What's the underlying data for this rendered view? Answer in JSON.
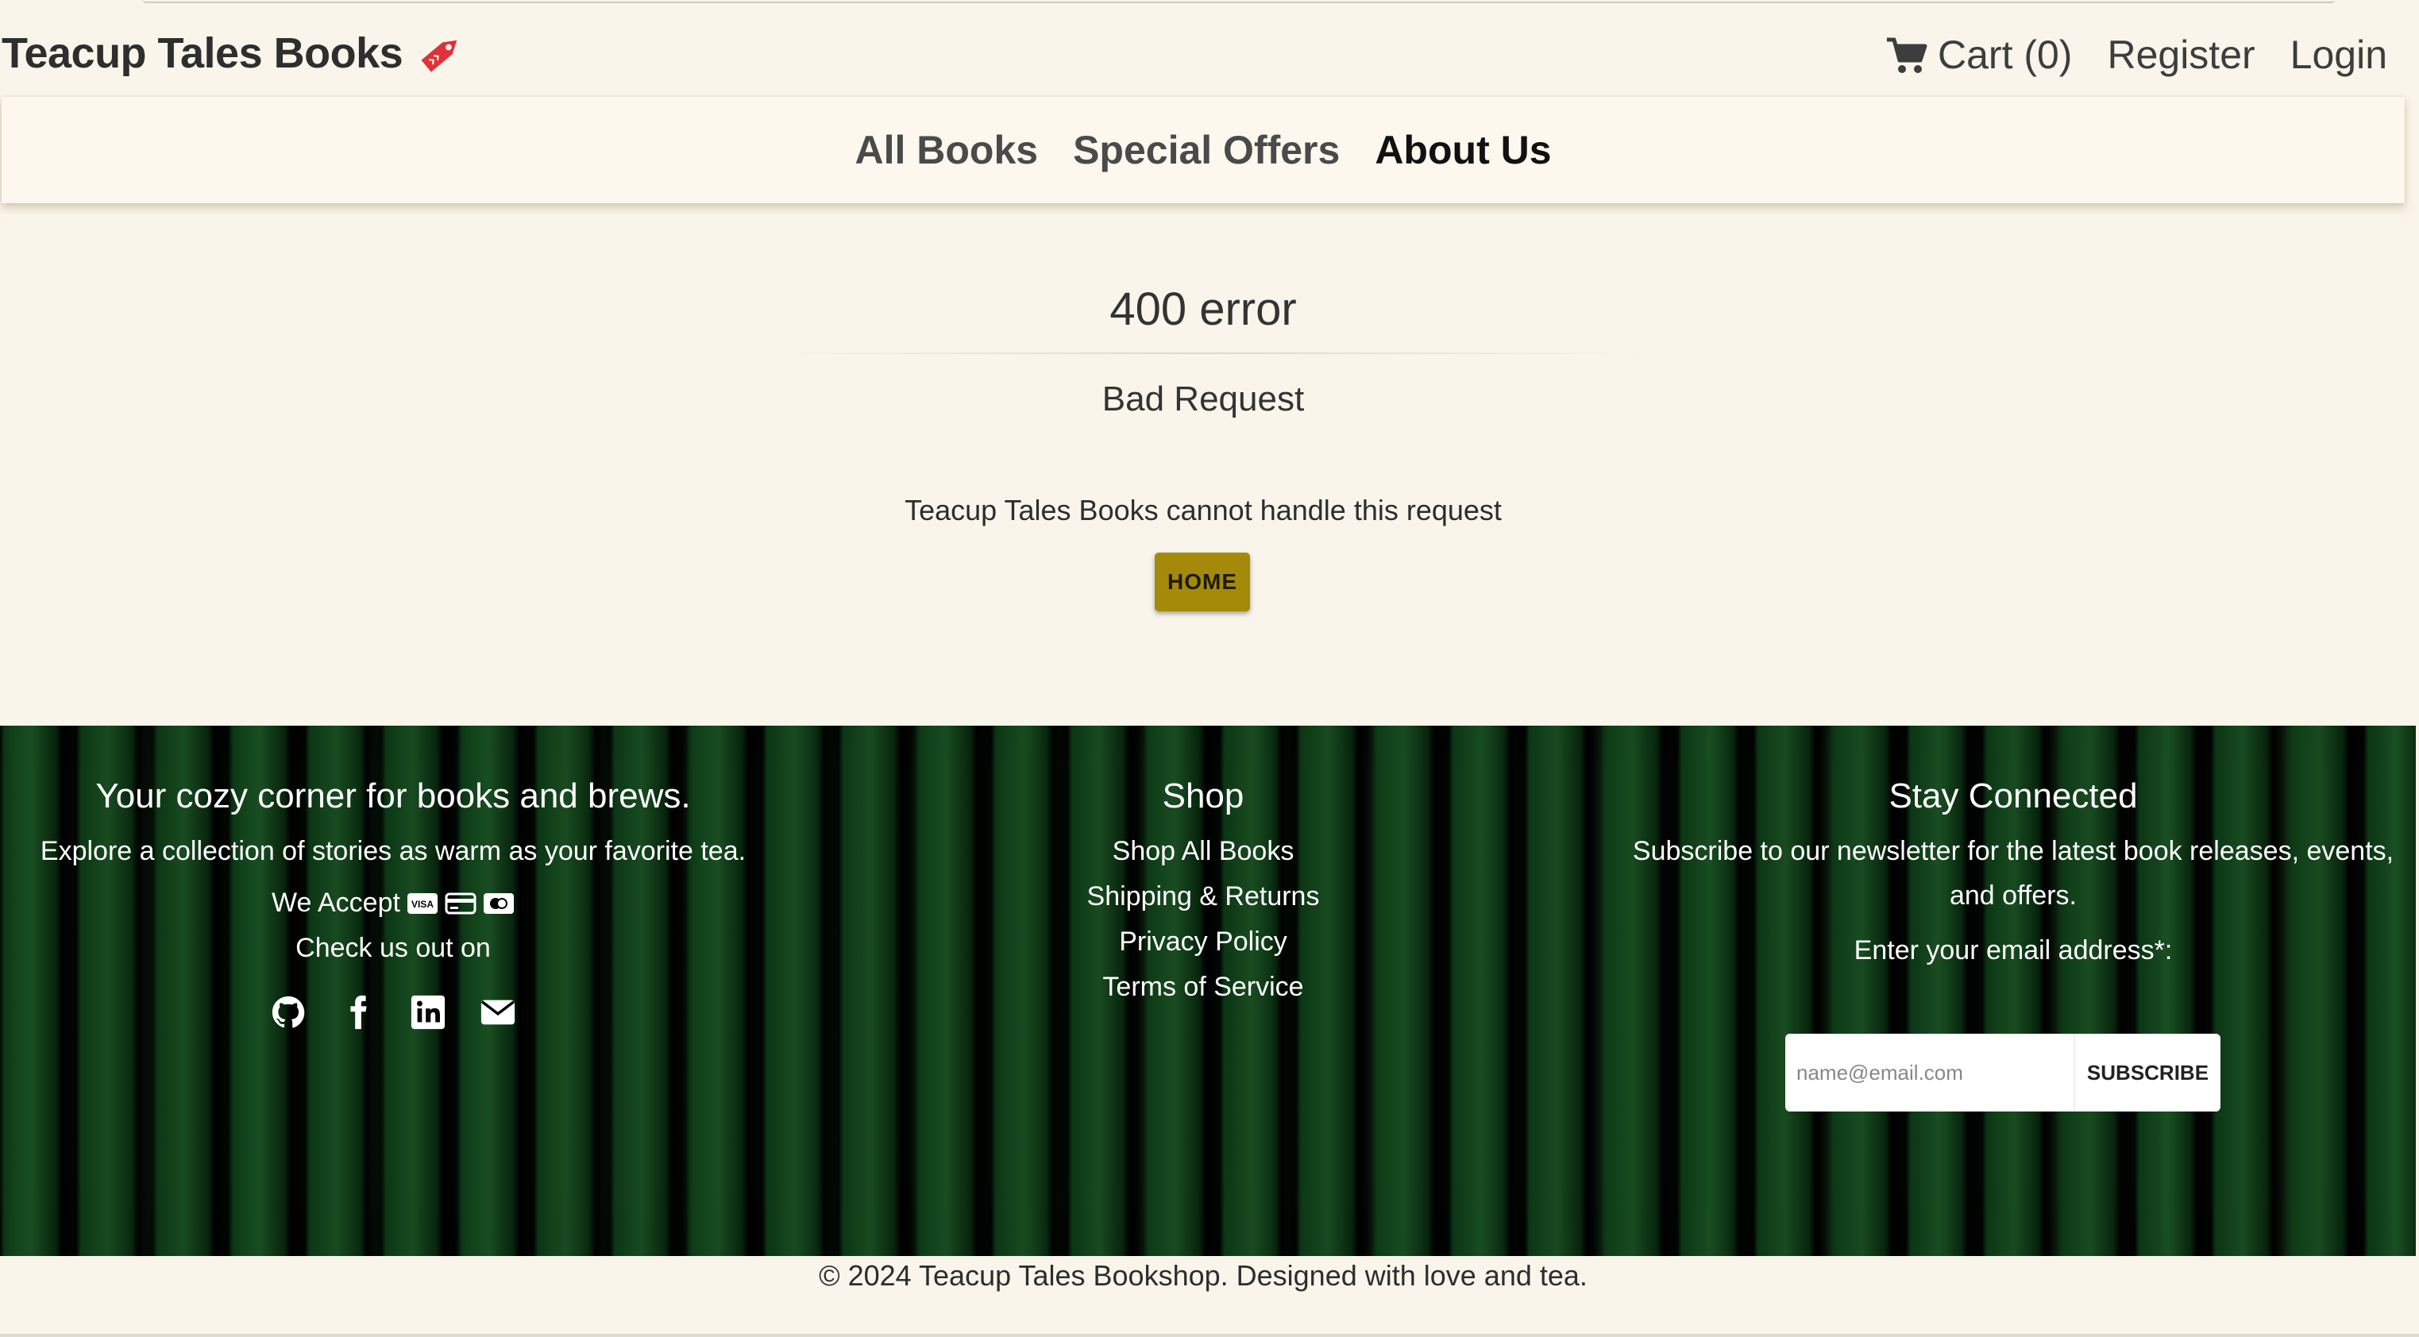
{
  "header": {
    "brand": "Teacup Tales Books",
    "cart_label": "Cart (0)",
    "register_label": "Register",
    "login_label": "Login"
  },
  "nav": {
    "items": [
      {
        "label": "All Books",
        "active": false
      },
      {
        "label": "Special Offers",
        "active": false
      },
      {
        "label": "About Us",
        "active": true
      }
    ]
  },
  "error": {
    "title": "400 error",
    "subtitle": "Bad Request",
    "message": "Teacup Tales Books cannot handle this request",
    "home_button": "HOME"
  },
  "footer": {
    "col1": {
      "heading": "Your cozy corner for books and brews.",
      "text": "Explore a collection of stories as warm as your favorite tea.",
      "accept_label": "We Accept",
      "check_label": "Check us out on",
      "payment_icons": [
        "visa-icon",
        "credit-card-icon",
        "mastercard-icon"
      ],
      "social_icons": [
        "github-icon",
        "facebook-icon",
        "linkedin-icon",
        "envelope-icon"
      ]
    },
    "col2": {
      "heading": "Shop",
      "links": [
        "Shop All Books",
        "Shipping & Returns",
        "Privacy Policy",
        "Terms of Service"
      ]
    },
    "col3": {
      "heading": "Stay Connected",
      "text": "Subscribe to our newsletter for the latest book releases, events, and offers.",
      "email_label": "Enter your email address*:",
      "email_placeholder": "name@email.com",
      "subscribe_label": "SUBSCRIBE"
    },
    "copyright": "© 2024 Teacup Tales Bookshop. Designed with love and tea."
  },
  "colors": {
    "background": "#f9f5ea",
    "home_button": "#a58a0a",
    "brand_tag": "#e0313a"
  }
}
